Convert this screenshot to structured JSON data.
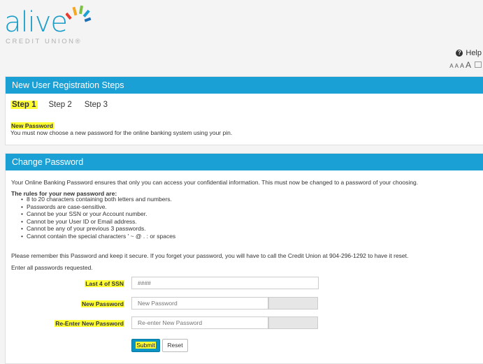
{
  "brand": {
    "name": "alive",
    "tagline": "CREDIT UNION®"
  },
  "header": {
    "help_label": "Help",
    "font_sizes": [
      "A",
      "A",
      "A",
      "A"
    ]
  },
  "registration": {
    "title": "New User Registration Steps",
    "steps": [
      "Step 1",
      "Step 2",
      "Step 3"
    ],
    "active_step": "Step 1",
    "section_label": "New Password",
    "section_desc": "You must now choose a new password for the online banking system using your pin."
  },
  "change_password": {
    "title": "Change Password",
    "intro": "Your Online Banking Password ensures that only you can access your confidential information. This must now be changed to a password of your choosing.",
    "rules_title": "The rules for your new password are:",
    "rules": [
      "8 to 20 characters containing both letters and numbers.",
      "Passwords are case-sensitive.",
      "Cannot be your SSN or your Account number.",
      "Cannot be your User ID or Email address.",
      "Cannot be any of your previous 3 passwords.",
      "Cannot contain the special characters ' ~ @ . : or spaces"
    ],
    "reminder": "Please remember this Password and keep it secure. If you forget your password, you will have to call the Credit Union at 904-296-1292 to have it reset.",
    "enter_all": "Enter all passwords requested.",
    "ssn_label": "Last 4 of SSN",
    "ssn_placeholder": "####",
    "new_pw_label": "New Password",
    "new_pw_placeholder": "New Password",
    "reenter_label": "Re-Enter New Password",
    "reenter_placeholder": "Re-enter New Password",
    "submit_label": "Submit",
    "reset_label": "Reset"
  },
  "colors": {
    "accent": "#1ba0d6",
    "highlight": "#ffff33",
    "button": "#0a93c4"
  }
}
